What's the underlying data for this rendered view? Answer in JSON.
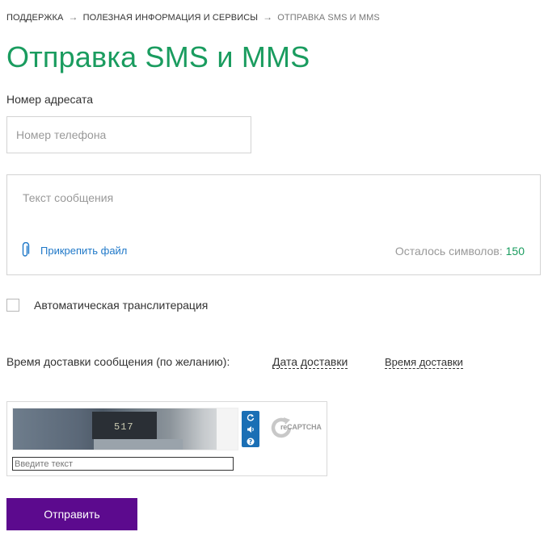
{
  "breadcrumb": {
    "items": [
      "ПОДДЕРЖКА",
      "ПОЛЕЗНАЯ ИНФОРМАЦИЯ И СЕРВИСЫ",
      "ОТПРАВКА SMS И MMS"
    ],
    "separator": "→"
  },
  "page": {
    "title": "Отправка SMS и MMS"
  },
  "recipient": {
    "label": "Номер адресата",
    "phone_placeholder": "Номер телефона",
    "phone_value": ""
  },
  "message": {
    "placeholder": "Текст сообщения",
    "value": "",
    "attach_label": "Прикрепить файл",
    "chars_left_label": "Осталось символов:",
    "chars_left_count": "150"
  },
  "translit": {
    "label": "Автоматическая транслитерация",
    "checked": false
  },
  "delivery": {
    "label": "Время доставки сообщения (по желанию):",
    "date_label": "Дата доставки",
    "time_label": "Время доставки"
  },
  "captcha": {
    "image_text": "517",
    "input_placeholder": "Введите текст",
    "logo_text": "reCAPTCHA",
    "controls": [
      "refresh-icon",
      "audio-icon",
      "help-icon"
    ]
  },
  "submit": {
    "label": "Отправить"
  },
  "colors": {
    "title_green": "#1a9c5f",
    "link_blue": "#1f78c8",
    "button_purple": "#5c0a8e",
    "captcha_blue": "#1a6fb5"
  }
}
